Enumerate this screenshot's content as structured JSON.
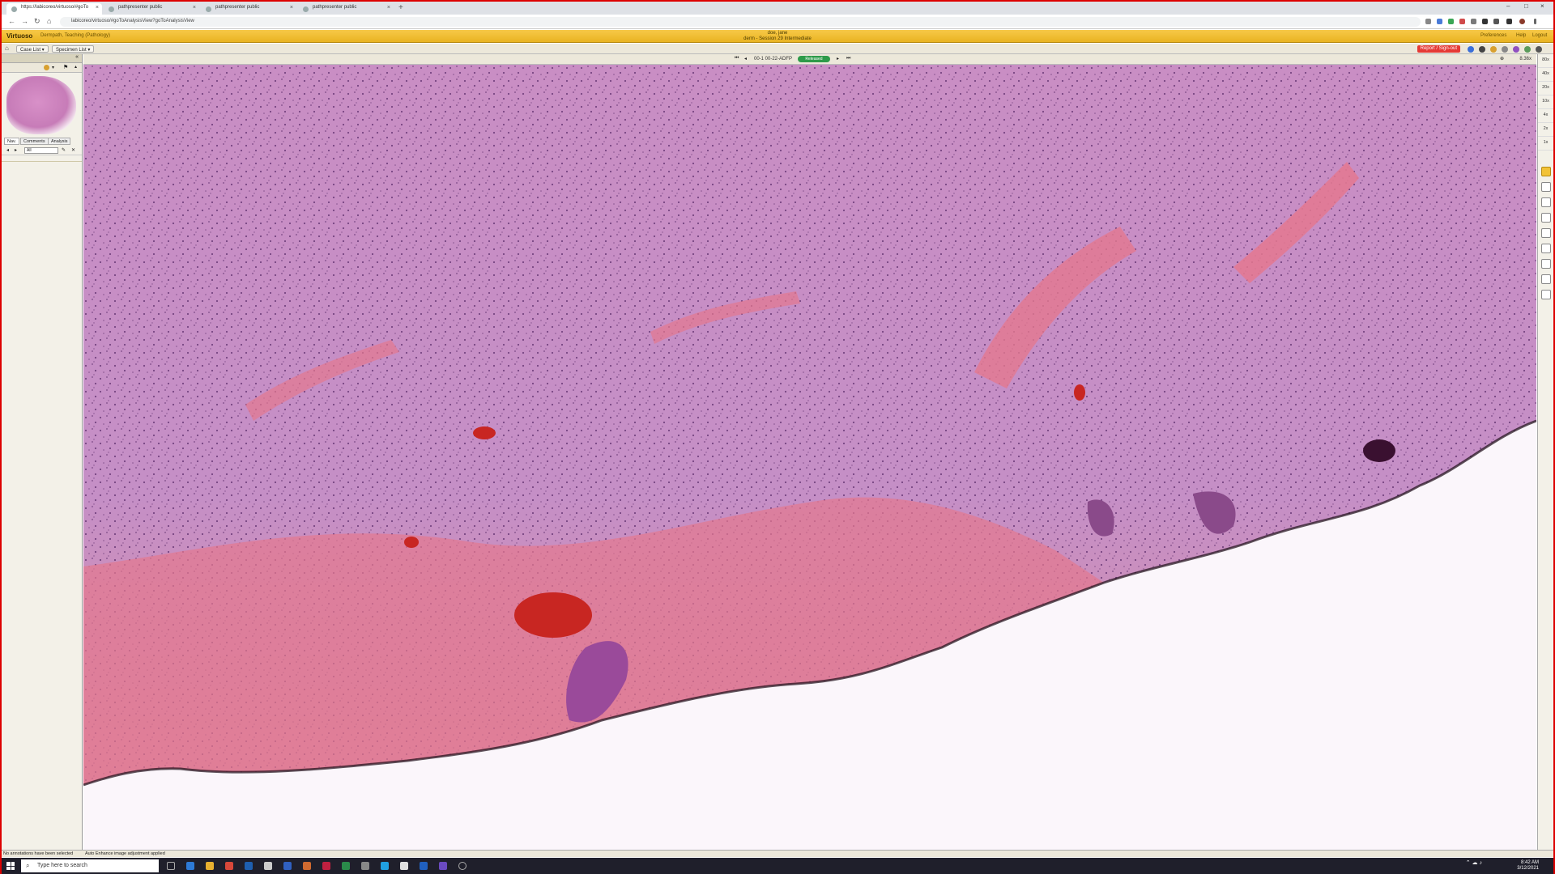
{
  "browser": {
    "tabs": [
      {
        "label": "https://labicoreo/virtuoso/#goTo",
        "active": true
      },
      {
        "label": "pathpresenter public",
        "active": false
      },
      {
        "label": "pathpresenter public",
        "active": false
      },
      {
        "label": "pathpresenter public",
        "active": false
      }
    ],
    "new_tab": "+",
    "url": "labicoreo/virtuoso/#goToAnalysisView?goToAnalysisView",
    "window_controls": [
      "–",
      "□",
      "×"
    ]
  },
  "app": {
    "brand": "Virtuoso",
    "context": "Dermpath, Teaching (Pathology)",
    "patient_name": "doe, jane",
    "case_title": "derm - Session 29 Intermediate",
    "top_links": [
      "Preferences",
      "Help",
      "Logout"
    ],
    "case_list": "Case List ▾",
    "specimen_list": "Specimen List ▾",
    "report_button": "Report / Sign-out"
  },
  "left_panel": {
    "tabs": [
      "Nav.",
      "Comments",
      "Analysis"
    ],
    "filter_value": "All"
  },
  "viewer": {
    "slide_id": "00-1 00-22-ADFP",
    "slide_status": "Released",
    "zoom": "8.36x"
  },
  "zoom_steps": [
    "80x",
    "40x",
    "20x",
    "10x",
    "4x",
    "2x",
    "1x"
  ],
  "status": {
    "left": "No annotations have been selected",
    "viewer": "Auto Enhance image adjustment applied"
  },
  "taskbar": {
    "search_placeholder": "Type here to search",
    "time": "8:42 AM",
    "date": "3/12/2021"
  },
  "colors": {
    "app_header": "#e9b321",
    "report": "#e53935",
    "status_released": "#2e9b4a",
    "tissue_dermis": "#c98ec4",
    "tissue_collagen": "#e4788f",
    "tissue_vessel": "#c82622"
  }
}
